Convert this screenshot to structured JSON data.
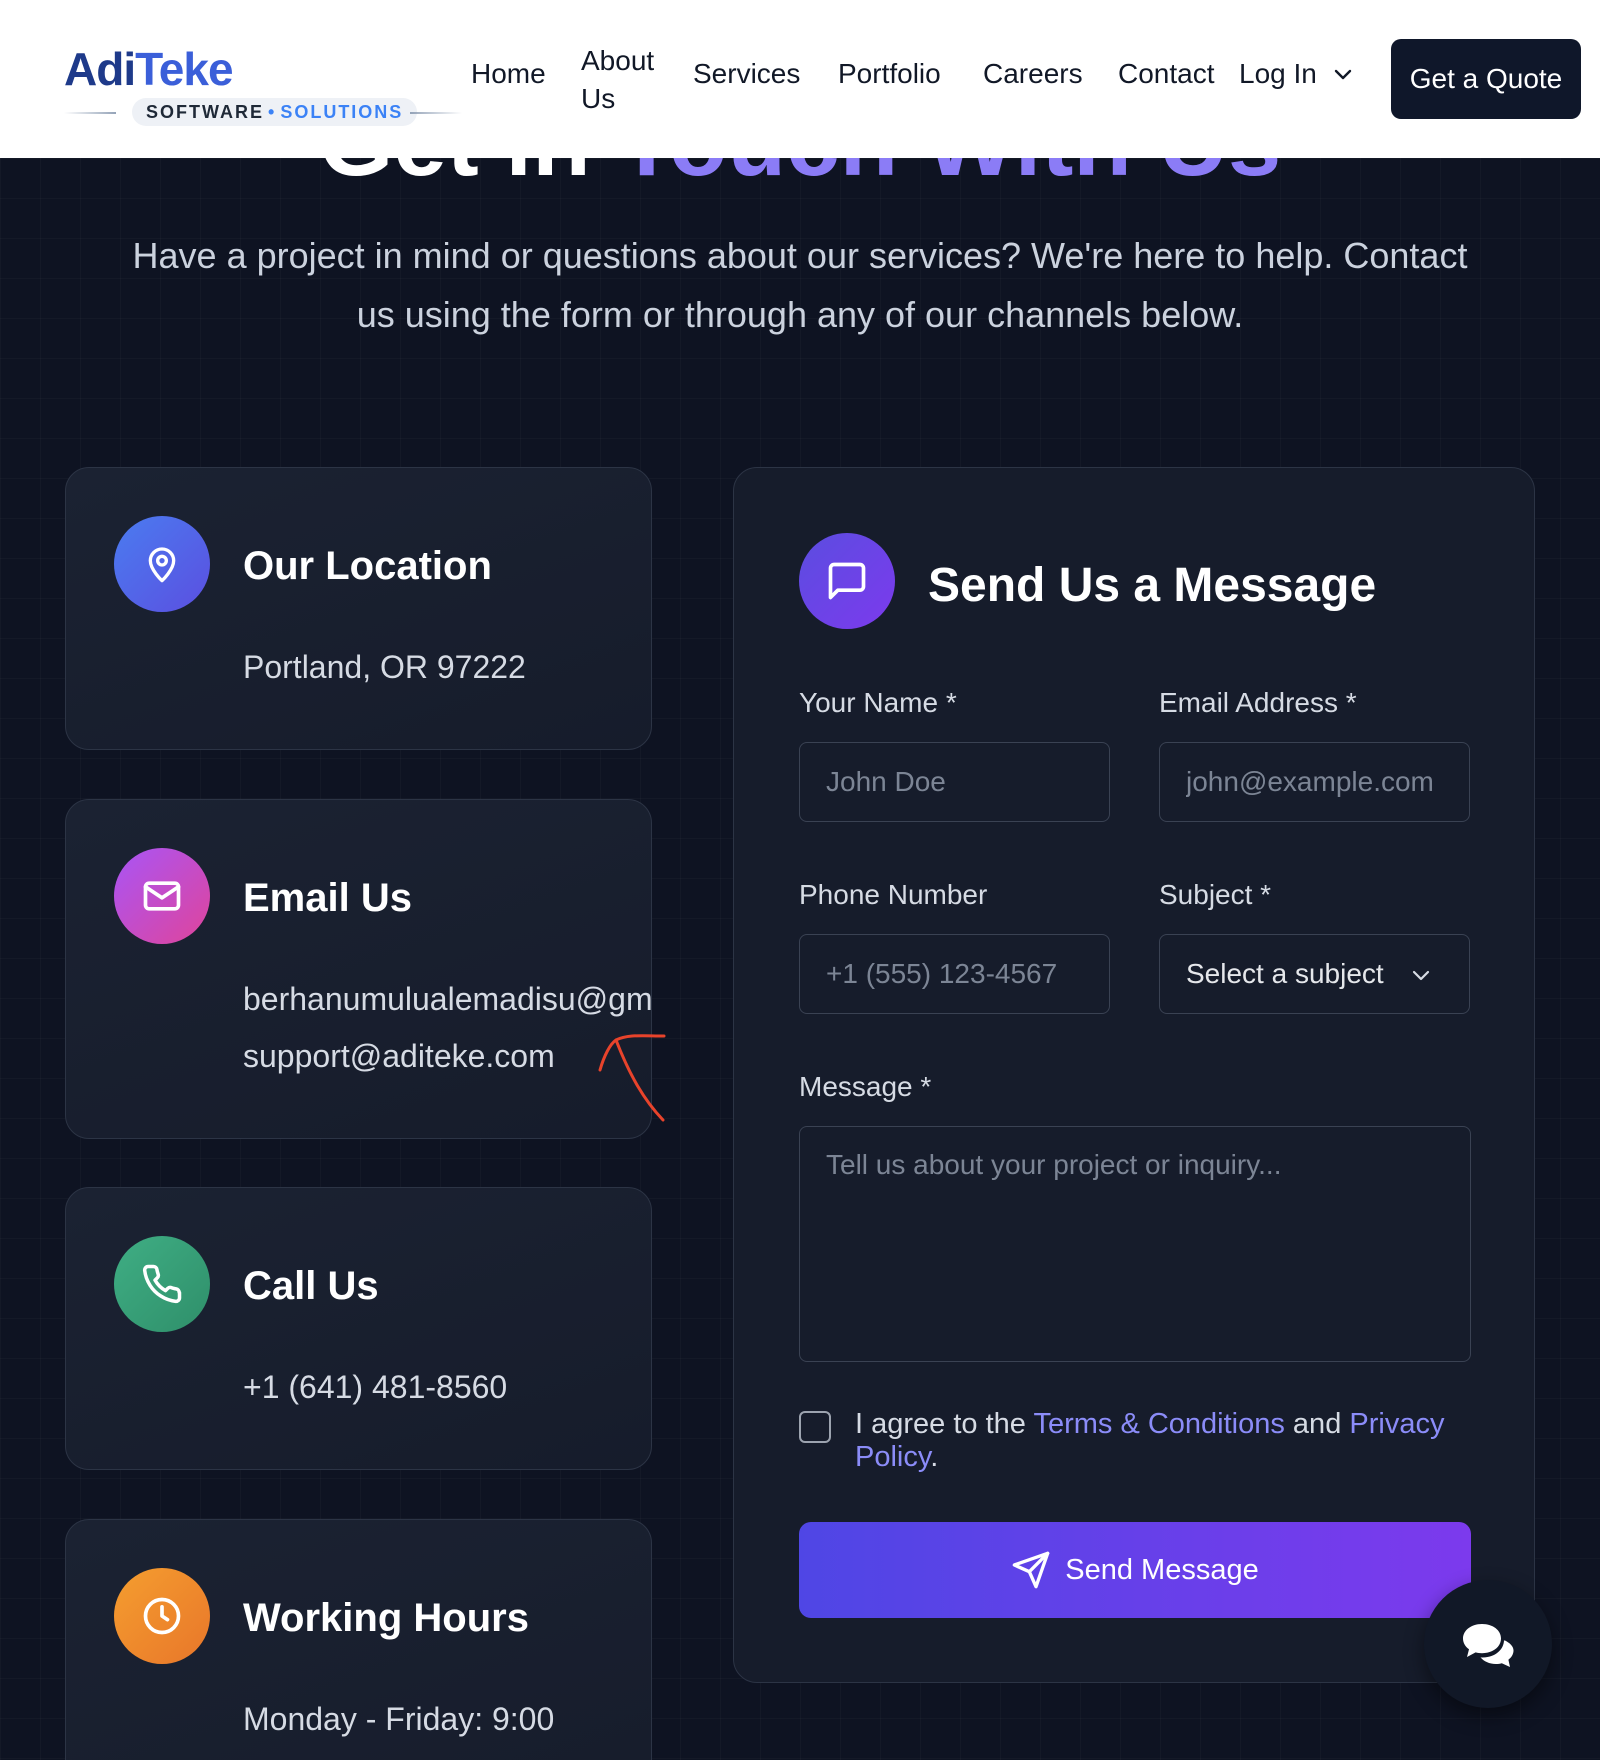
{
  "brand": {
    "name_part1": "Adi",
    "name_part2": "Teke",
    "tag_part1": "SOFTWARE",
    "tag_sep": "•",
    "tag_part2": "SOLUTIONS"
  },
  "nav": {
    "home": "Home",
    "about": "About Us",
    "services": "Services",
    "portfolio": "Portfolio",
    "careers": "Careers",
    "contact": "Contact",
    "login": "Log In",
    "quote_button": "Get a Quote"
  },
  "hero": {
    "heading_part1": "Get in ",
    "heading_part2": "Touch With Us",
    "subtitle": "Have a project in mind or questions about our services? We're here to help. Contact us using the form or through any of our channels below."
  },
  "cards": {
    "location": {
      "title": "Our Location",
      "line1": "Portland, OR 97222"
    },
    "email": {
      "title": "Email Us",
      "line1": "berhanumulualemadisu@gm",
      "line2": "support@aditeke.com"
    },
    "phone": {
      "title": "Call Us",
      "line1": "+1 (641) 481-8560"
    },
    "hours": {
      "title": "Working Hours",
      "line1": "Monday - Friday: 9:00"
    }
  },
  "form": {
    "title": "Send Us a Message",
    "name_label": "Your Name *",
    "name_placeholder": "John Doe",
    "email_label": "Email Address *",
    "email_placeholder": "john@example.com",
    "phone_label": "Phone Number",
    "phone_placeholder": "+1 (555) 123-4567",
    "subject_label": "Subject *",
    "subject_value": "Select a subject",
    "message_label": "Message *",
    "message_placeholder": "Tell us about your project or inquiry...",
    "agree_prefix": "I agree to the ",
    "agree_terms": "Terms & Conditions",
    "agree_and": " and ",
    "agree_privacy": "Privacy Policy",
    "agree_suffix": ".",
    "submit_label": "Send Message"
  },
  "colors": {
    "accent": "#6d5ce8",
    "location_icon": "#4f6ef2",
    "email_icon": "#c04ad6",
    "phone_icon": "#3fa77a",
    "hours_icon": "#ee8a2a",
    "annotation": "#e8432b"
  },
  "icons": {
    "location": "map-pin-icon",
    "email": "mail-icon",
    "phone": "phone-icon",
    "hours": "clock-icon",
    "form": "message-square-icon",
    "submit": "send-icon",
    "chat": "chat-bubbles-icon"
  }
}
